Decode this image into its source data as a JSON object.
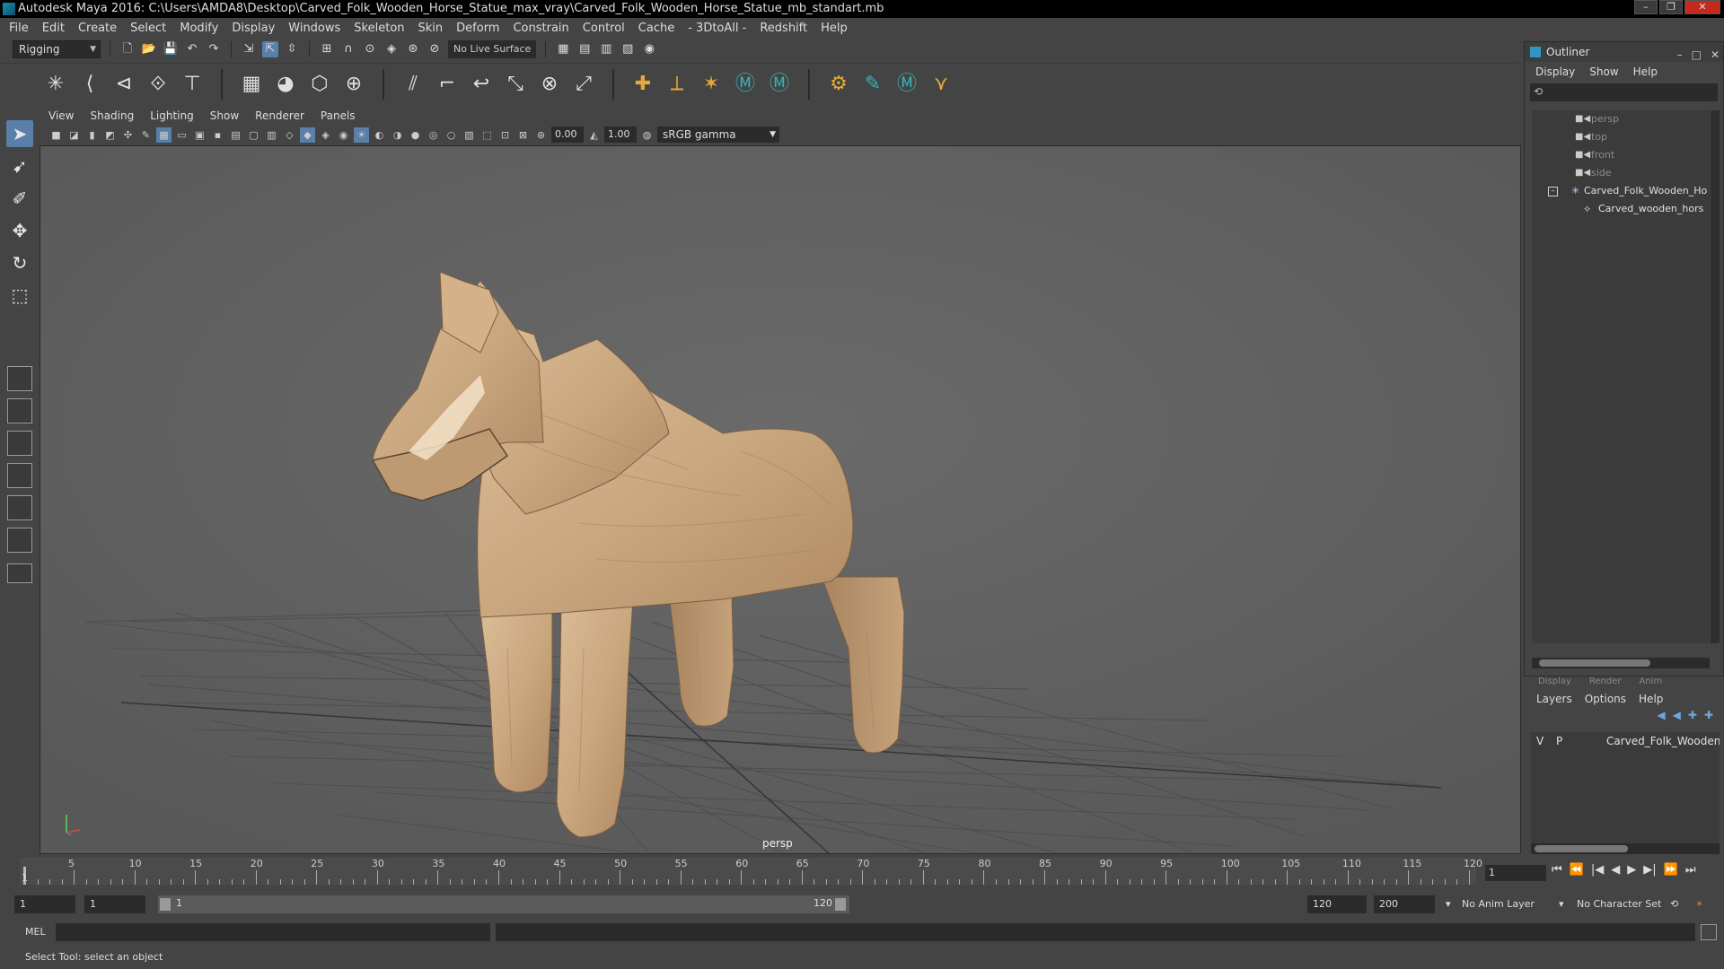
{
  "window": {
    "title": "Autodesk Maya 2016: C:\\Users\\AMDA8\\Desktop\\Carved_Folk_Wooden_Horse_Statue_max_vray\\Carved_Folk_Wooden_Horse_Statue_mb_standart.mb"
  },
  "menubar": [
    "File",
    "Edit",
    "Create",
    "Select",
    "Modify",
    "Display",
    "Windows",
    "Skeleton",
    "Skin",
    "Deform",
    "Constrain",
    "Control",
    "Cache",
    "- 3DtoAll -",
    "Redshift",
    "Help"
  ],
  "statusline": {
    "menuset": "Rigging",
    "live_surface": "No Live Surface"
  },
  "viewport": {
    "menu": [
      "View",
      "Shading",
      "Lighting",
      "Show",
      "Renderer",
      "Panels"
    ],
    "exposure": "0.00",
    "gamma": "1.00",
    "color_space": "sRGB gamma",
    "camera_label": "persp",
    "model_color": "#c9a77f",
    "background": "#606060"
  },
  "outliner": {
    "title": "Outliner",
    "menu": [
      "Display",
      "Show",
      "Help"
    ],
    "items": [
      {
        "label": "persp",
        "icon": "camera-icon",
        "dim": true
      },
      {
        "label": "top",
        "icon": "camera-icon",
        "dim": true
      },
      {
        "label": "front",
        "icon": "camera-icon",
        "dim": true
      },
      {
        "label": "side",
        "icon": "camera-icon",
        "dim": true
      },
      {
        "label": "Carved_Folk_Wooden_Ho",
        "icon": "group-icon",
        "dim": false
      },
      {
        "label": "Carved_wooden_hors",
        "icon": "mesh-icon",
        "dim": false
      }
    ]
  },
  "layer_editor": {
    "tabs": [
      "Display",
      "Render",
      "Anim"
    ],
    "menu": [
      "Layers",
      "Options",
      "Help"
    ],
    "layer": {
      "v": "V",
      "p": "P",
      "name": "Carved_Folk_Wooden"
    }
  },
  "timeline": {
    "ticks": [
      "5",
      "10",
      "15",
      "20",
      "25",
      "30",
      "35",
      "40",
      "45",
      "50",
      "55",
      "60",
      "65",
      "70",
      "75",
      "80",
      "85",
      "90",
      "95",
      "100",
      "105",
      "110",
      "115",
      "120"
    ],
    "current_frame_marker": "1",
    "current_frame": "1"
  },
  "range": {
    "start": "1",
    "playback_start": "1",
    "slider_start": "1",
    "slider_end": "120",
    "playback_end": "120",
    "end": "200",
    "anim_layer": "No Anim Layer",
    "character_set": "No Character Set"
  },
  "command": {
    "label": "MEL"
  },
  "help_line": "Select Tool: select an object"
}
